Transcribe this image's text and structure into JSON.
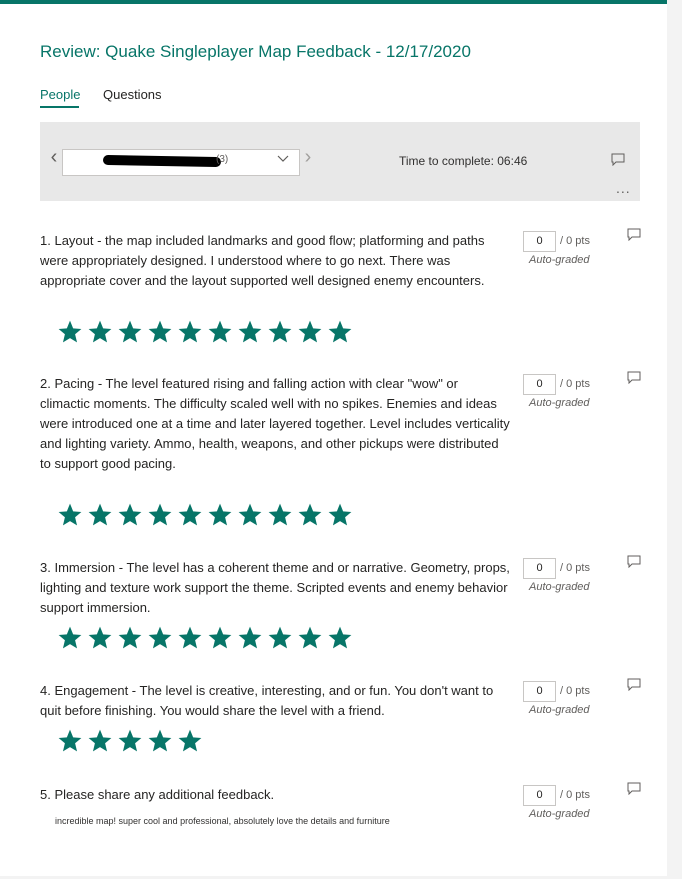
{
  "title": "Review: Quake Singleplayer Map Feedback - 12/17/2020",
  "tabs": {
    "people": "People",
    "questions": "Questions"
  },
  "respondent": {
    "count": "(3)"
  },
  "time_to_complete": "Time to complete: 06:46",
  "more": "...",
  "colors": {
    "accent": "#077568",
    "star": "#077568"
  },
  "points": {
    "value": "0",
    "total": "/ 0 pts",
    "graded": "Auto-graded"
  },
  "questions": [
    {
      "num": "1.",
      "text": "Layout - the map included landmarks and good flow; platforming and paths were appropriately designed. I understood where to go next. There was appropriate cover and the layout supported well designed enemy encounters.",
      "rating": 10
    },
    {
      "num": "2.",
      "text": "Pacing - The level featured rising and falling action with clear \"wow\" or climactic moments. The difficulty scaled well with no spikes. Enemies and ideas were introduced one at a time and later layered together. Level includes verticality and lighting variety. Ammo, health, weapons, and other pickups were distributed to support good pacing.",
      "rating": 10
    },
    {
      "num": "3.",
      "text": "Immersion - The level has a coherent theme and or narrative. Geometry, props, lighting and texture work support the theme. Scripted events and enemy behavior support immersion.",
      "rating": 10
    },
    {
      "num": "4.",
      "text": "Engagement - The level is creative, interesting, and or fun. You don't want to quit before finishing. You would share the level with a friend.",
      "rating": 5
    },
    {
      "num": "5.",
      "text": "Please share any additional feedback.",
      "answer": "incredible map! super cool and professional, absolutely love the details and furniture"
    }
  ]
}
